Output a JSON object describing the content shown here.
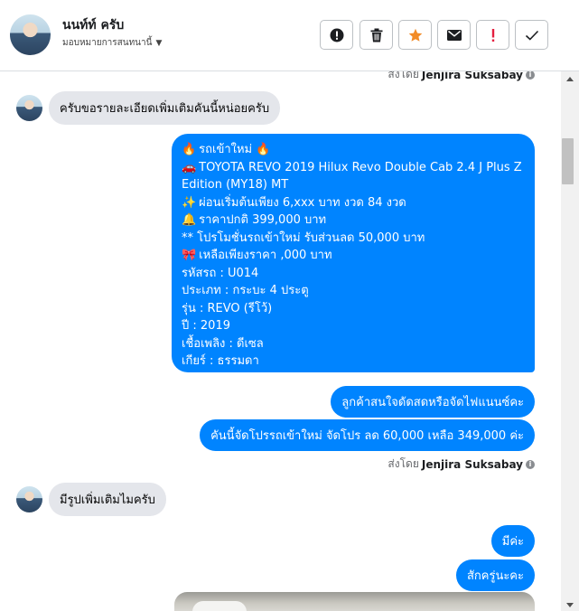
{
  "header": {
    "name": "นนท์ท์ ครับ",
    "assign_label": "มอบหมายการสนทนานี้"
  },
  "toolbar": {
    "icons": [
      "alert-circle-icon",
      "trash-icon",
      "star-icon",
      "envelope-icon",
      "exclamation-icon",
      "check-icon"
    ],
    "accent_star": "#f28c28",
    "accent_alert": "#e41e3f"
  },
  "chat": {
    "top_sent_by": {
      "prefix": "ส่งโดย",
      "name": "Jenjira Suksabay"
    },
    "msg_in_1": "ครับขอรายละเอียดเพิ่มเติมคันนี้หน่อยครับ",
    "car_listing": {
      "lines": [
        {
          "emoji": "🔥",
          "text": "รถเข้าใหม่",
          "emoji_after": "🔥"
        },
        {
          "emoji": "🚗",
          "text": "TOYOTA REVO 2019 Hilux Revo Double Cab 2.4 J Plus Z Edition (MY18) MT"
        },
        {
          "emoji": "✨",
          "text": "ผ่อนเริ่มต้นเพียง 6,xxx บาท งวด 84 งวด"
        },
        {
          "emoji": "🔔",
          "text": "ราคาปกติ 399,000 บาท"
        },
        {
          "emoji": "",
          "text": "** โปรโมชั่นรถเข้าใหม่ รับส่วนลด 50,000 บาท"
        },
        {
          "emoji": "🎀",
          "text": "เหลือเพียงราคา ,000 บาท"
        },
        {
          "emoji": "",
          "text": "รหัสรถ : U014"
        },
        {
          "emoji": "",
          "text": "ประเภท : กระบะ 4 ประตู"
        },
        {
          "emoji": "",
          "text": "รุ่น : REVO (รีโว้)"
        },
        {
          "emoji": "",
          "text": "ปี : 2019"
        },
        {
          "emoji": "",
          "text": "เชื้อเพลิง : ดีเซล"
        },
        {
          "emoji": "",
          "text": "เกียร์ : ธรรมดา"
        }
      ]
    },
    "msg_out_2": "ลูกค้าสนใจดัดสดหรือจัดไฟแนนซ์คะ",
    "msg_out_3": "คันนี้จัดโปรรถเข้าใหม่ จัดโปร ลด 60,000 เหลือ 349,000 ค่ะ",
    "sent_by": {
      "prefix": "ส่งโดย",
      "name": "Jenjira Suksabay"
    },
    "msg_in_2": "มีรูปเพิ่มเติมไมครับ",
    "msg_out_4": "มีค่ะ",
    "msg_out_5": "สักครู่นะคะ"
  },
  "colors": {
    "bubble_out": "#0084ff",
    "bubble_in": "#e4e6eb"
  }
}
